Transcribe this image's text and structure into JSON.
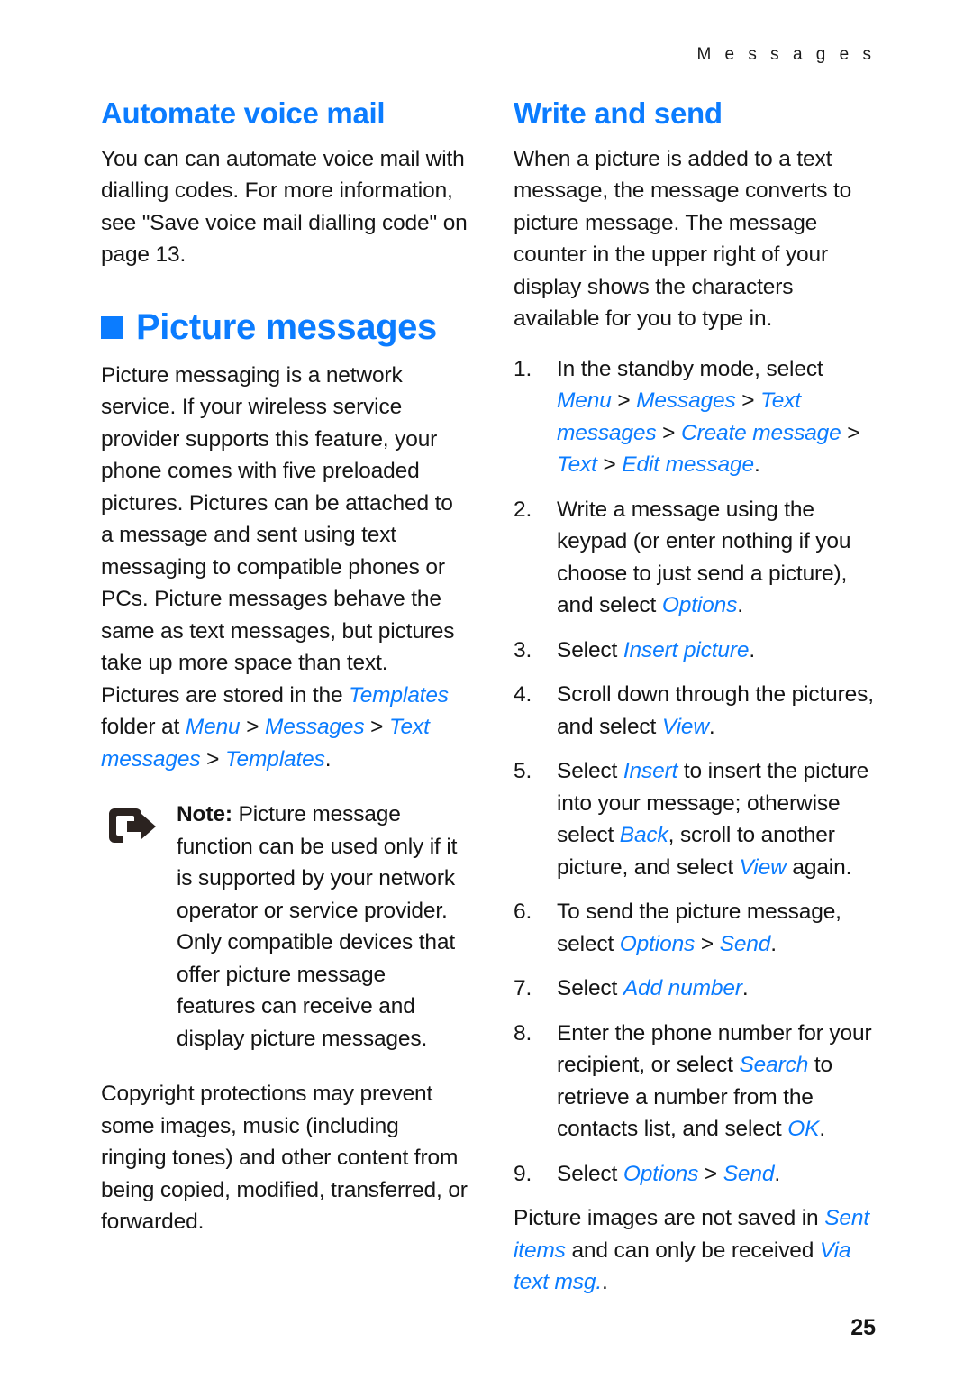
{
  "header": {
    "running_title": "M e s s a g e s"
  },
  "colors": {
    "accent_blue": "#0b7cff",
    "body_text": "#161616"
  },
  "left_column": {
    "section_heading": "Automate voice mail",
    "intro_paragraph": "You can can automate voice mail with dialling codes. For more information, see \"Save voice mail dialling code\" on page 13.",
    "chapter_heading": "Picture messages",
    "chapter_bullet_icon": "square-bullet-icon",
    "paragraph_1_part1": "Picture messaging is a network service. If your wireless service provider supports this feature, your phone comes with five preloaded pictures. Pictures can be attached to a message and sent using text messaging to compatible phones or PCs. Picture messages behave the same as text messages, but pictures take up more space than text. Pictures are stored in the ",
    "paragraph_1_templates": "Templates",
    "paragraph_1_part2": " folder at ",
    "paragraph_1_menu": "Menu",
    "paragraph_1_sep1": " > ",
    "paragraph_1_messages": "Messages",
    "paragraph_1_sep2": " > ",
    "paragraph_1_textmessages": "Text messages",
    "paragraph_1_sep3": " > ",
    "paragraph_1_templates2": "Templates",
    "paragraph_1_end": ".",
    "note": {
      "icon": "note-arrow-icon",
      "label": "Note:",
      "text": " Picture message function can be used only if it is supported by your network operator or service provider. Only compatible devices that offer picture message features can receive and display picture messages."
    },
    "paragraph_2": "Copyright protections may prevent some images, music (including ringing tones) and other content from being copied, modified, transferred, or forwarded."
  },
  "right_column": {
    "section_heading": "Write and send",
    "intro_paragraph": "When a picture is added to a text message, the message converts to picture message. The message counter in the upper right of your display shows the characters available for you to type in.",
    "steps": [
      {
        "number": "1.",
        "pre": "In the standby mode, select ",
        "ui_path": [
          "Menu",
          "Messages",
          "Text messages",
          "Create message",
          "Text",
          "Edit message"
        ],
        "post": "."
      },
      {
        "number": "2.",
        "pre": "Write a message using the keypad (or enter nothing if you choose to just send a picture), and select ",
        "ui_path": [
          "Options"
        ],
        "post": "."
      },
      {
        "number": "3.",
        "pre": "Select ",
        "ui_path": [
          "Insert picture"
        ],
        "post": "."
      },
      {
        "number": "4.",
        "pre": "Scroll down through the pictures, and select ",
        "ui_path": [
          "View"
        ],
        "post": "."
      },
      {
        "number": "5.",
        "pre": "Select ",
        "ui_1": "Insert",
        "mid_1": " to insert the picture into your message; otherwise select ",
        "ui_2": "Back",
        "mid_2": ", scroll to another picture, and select ",
        "ui_3": "View",
        "post": " again."
      },
      {
        "number": "6.",
        "pre": "To send the picture message, select ",
        "ui_path": [
          "Options",
          "Send"
        ],
        "post": "."
      },
      {
        "number": "7.",
        "pre": "Select ",
        "ui_path": [
          "Add number"
        ],
        "post": "."
      },
      {
        "number": "8.",
        "pre": "Enter the phone number for your recipient, or select ",
        "ui_1": "Search",
        "mid_1": " to retrieve a number from the contacts list, and select ",
        "ui_2": "OK",
        "post": "."
      },
      {
        "number": "9.",
        "pre": "Select ",
        "ui_path": [
          "Options",
          "Send"
        ],
        "post": "."
      }
    ],
    "closing_pre": "Picture images are not saved in ",
    "closing_ui_1": "Sent items",
    "closing_mid": " and can only be received ",
    "closing_ui_2": "Via text msg.",
    "closing_post": "."
  },
  "footer": {
    "page_number": "25"
  }
}
